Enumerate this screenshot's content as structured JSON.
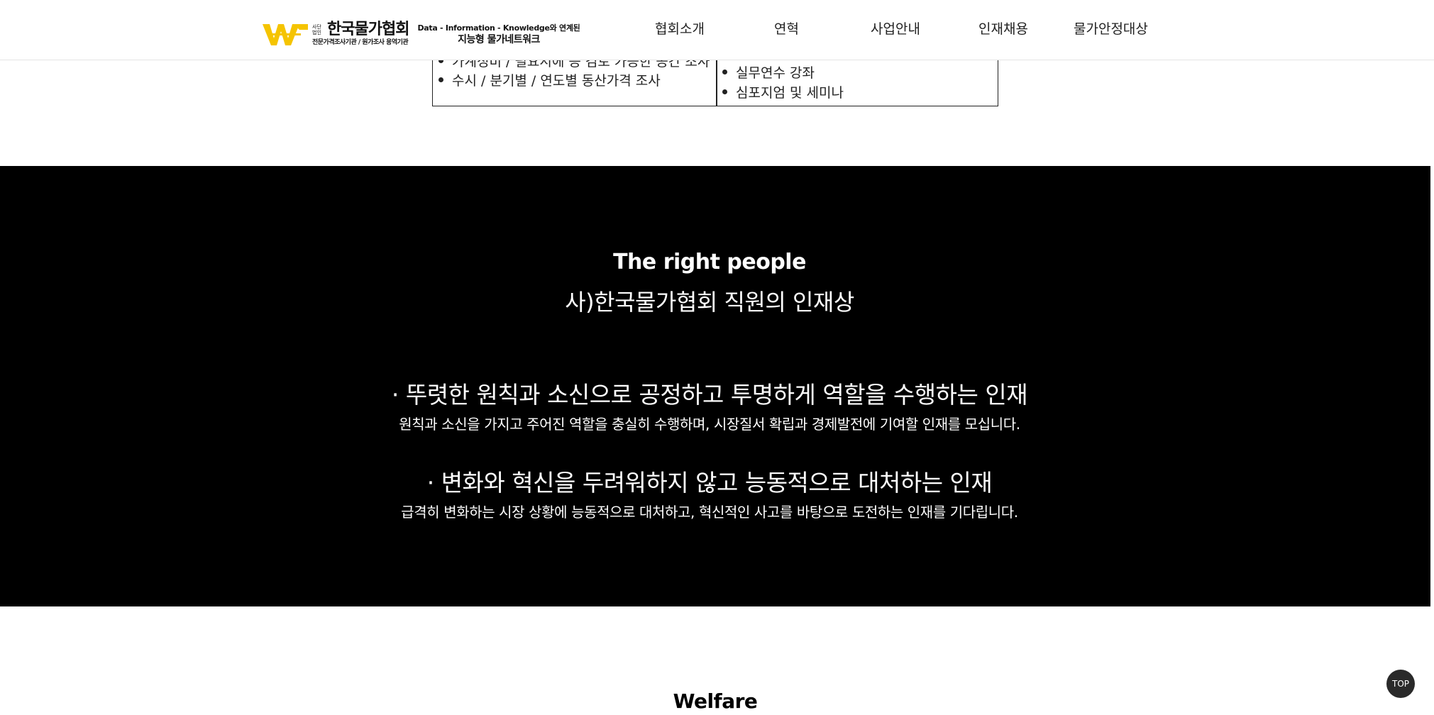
{
  "header": {
    "logo": {
      "small_text": "사단법인",
      "name": "한국물가협회",
      "subtitle": "전문가격조사기관 / 원가조사 용역기관",
      "tagline_1": "Data - Information - Knowledge와 연계된",
      "tagline_2": "지능형 물가네트워크",
      "brand_color": "#f5c400"
    },
    "nav": [
      "협회소개",
      "연혁",
      "사업안내",
      "인재채용",
      "물가안정대상"
    ]
  },
  "table_fragment": {
    "left_items": [
      "가계정비 / 필요시에 등 검토 가능한 공간 조사",
      "수시 / 분기별 / 연도별 동산가격 조사"
    ],
    "right_items": [
      "실무연수 강좌",
      "심포지엄 및 세미나"
    ]
  },
  "people": {
    "title": "The right people",
    "subtitle": "사)한국물가협회 직원의 인재상",
    "values": [
      {
        "heading": "· 뚜렷한 원칙과 소신으로 공정하고 투명하게 역할을 수행하는 인재",
        "description": "원칙과 소신을 가지고 주어진 역할을 충실히 수행하며, 시장질서 확립과 경제발전에 기여할 인재를 모십니다."
      },
      {
        "heading": "· 변화와 혁신을 두려워하지 않고 능동적으로 대처하는 인재",
        "description": "급격히 변화하는 시장 상황에 능동적으로 대처하고, 혁신적인 사고를 바탕으로 도전하는 인재를 기다립니다."
      }
    ]
  },
  "welfare": {
    "title": "Welfare"
  },
  "top_button": {
    "label": "TOP"
  }
}
